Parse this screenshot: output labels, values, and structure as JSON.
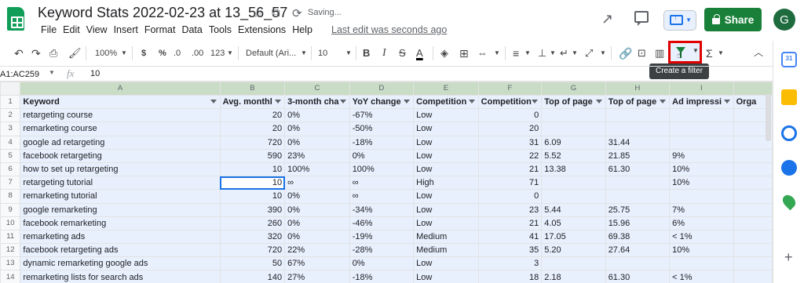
{
  "title_bar": {
    "doc_title": "Keyword Stats 2022-02-23 at 13_56_57",
    "saving_status": "Saving...",
    "menu": [
      "File",
      "Edit",
      "View",
      "Insert",
      "Format",
      "Data",
      "Tools",
      "Extensions",
      "Help"
    ],
    "last_edit": "Last edit was seconds ago",
    "share_label": "Share",
    "avatar_initial": "G"
  },
  "toolbar": {
    "zoom": "100%",
    "currency": "$",
    "percent": "%",
    "decrease_decimal": ".0",
    "increase_decimal": ".00",
    "more_formats": "123",
    "font": "Default (Ari...",
    "font_size": "10",
    "bold": "B",
    "italic": "I",
    "strikethrough": "S",
    "text_color": "A",
    "function": "Σ",
    "tooltip": "Create a filter"
  },
  "formula_bar": {
    "name_box": "A1:AC259",
    "fx": "fx",
    "value": "10"
  },
  "grid": {
    "column_letters": [
      "A",
      "B",
      "C",
      "D",
      "E",
      "F",
      "G",
      "H",
      "I"
    ],
    "row_numbers": [
      "1",
      "2",
      "3",
      "4",
      "5",
      "6",
      "7",
      "8",
      "9",
      "10",
      "11",
      "12",
      "13",
      "14"
    ],
    "headers": [
      "Keyword",
      "Avg. monthl",
      "3-month cha",
      "YoY change",
      "Competition",
      "Competition",
      "Top of page",
      "Top of page",
      "Ad impressi",
      "Orga"
    ],
    "rows": [
      [
        "retargeting course",
        "20",
        "0%",
        "-67%",
        "Low",
        "0",
        "",
        "",
        "",
        ""
      ],
      [
        "remarketing course",
        "20",
        "0%",
        "-50%",
        "Low",
        "20",
        "",
        "",
        "",
        ""
      ],
      [
        "google ad retargeting",
        "720",
        "0%",
        "-18%",
        "Low",
        "31",
        "6.09",
        "31.44",
        "",
        ""
      ],
      [
        "facebook retargeting",
        "590",
        "23%",
        "0%",
        "Low",
        "22",
        "5.52",
        "21.85",
        "9%",
        ""
      ],
      [
        "how to set up retargeting",
        "10",
        "100%",
        "100%",
        "Low",
        "21",
        "13.38",
        "61.30",
        "10%",
        ""
      ],
      [
        "retargeting tutorial",
        "10",
        "∞",
        "∞",
        "High",
        "71",
        "",
        "",
        "10%",
        ""
      ],
      [
        "remarketing tutorial",
        "10",
        "0%",
        "∞",
        "Low",
        "0",
        "",
        "",
        "",
        ""
      ],
      [
        "google remarketing",
        "390",
        "0%",
        "-34%",
        "Low",
        "23",
        "5.44",
        "25.75",
        "7%",
        ""
      ],
      [
        "facebook remarketing",
        "260",
        "0%",
        "-46%",
        "Low",
        "21",
        "4.05",
        "15.96",
        "6%",
        ""
      ],
      [
        "remarketing ads",
        "320",
        "0%",
        "-19%",
        "Medium",
        "41",
        "17.05",
        "69.38",
        "< 1%",
        ""
      ],
      [
        "facebook retargeting ads",
        "720",
        "22%",
        "-28%",
        "Medium",
        "35",
        "5.20",
        "27.64",
        "10%",
        ""
      ],
      [
        "dynamic remarketing google ads",
        "50",
        "67%",
        "0%",
        "Low",
        "3",
        "",
        "",
        "",
        ""
      ],
      [
        "remarketing lists for search ads",
        "140",
        "27%",
        "-18%",
        "Low",
        "18",
        "2.18",
        "61.30",
        "< 1%",
        ""
      ]
    ]
  },
  "colors": {
    "share_green": "#188038",
    "selection_blue": "#e8f0fe",
    "highlight_red": "#e00000",
    "header_green": "#c9dcc6"
  }
}
